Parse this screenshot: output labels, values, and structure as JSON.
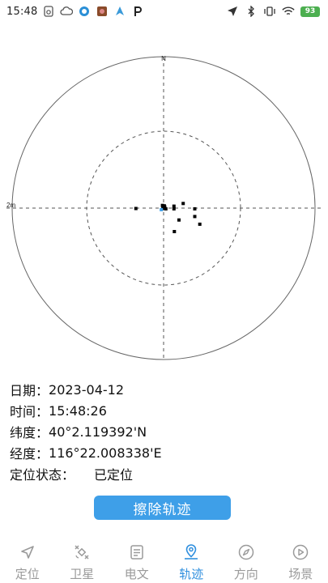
{
  "status_bar": {
    "time": "15:48",
    "battery": "93",
    "icons": [
      "sync-icon",
      "cloud-icon",
      "app-icon",
      "app-icon-2",
      "arrow-icon",
      "parking-icon",
      "location-icon",
      "bluetooth-icon",
      "vibrate-icon",
      "wifi-icon",
      "battery-icon"
    ]
  },
  "radar": {
    "north_label": "N",
    "scale_label": "2m",
    "points": [
      {
        "dx": 0.0,
        "dy": -0.2
      },
      {
        "dx": -0.3,
        "dy": -0.7
      },
      {
        "dx": 0.2,
        "dy": -0.6
      },
      {
        "dx": 0.3,
        "dy": -0.3
      },
      {
        "dx": -0.2,
        "dy": 0.1
      },
      {
        "dx": 0.6,
        "dy": 0.2
      },
      {
        "dx": -7.2,
        "dy": 0.1
      },
      {
        "dx": 2.7,
        "dy": -0.5
      },
      {
        "dx": 2.7,
        "dy": 0.2
      },
      {
        "dx": 5.1,
        "dy": -1.2
      },
      {
        "dx": 8.1,
        "dy": 0.2
      },
      {
        "dx": 8.1,
        "dy": 2.2
      },
      {
        "dx": 4.0,
        "dy": 3.1
      },
      {
        "dx": 9.4,
        "dy": 4.2
      },
      {
        "dx": 2.8,
        "dy": 6.1
      }
    ],
    "current_point": {
      "dx": -0.6,
      "dy": 0.4
    }
  },
  "info": {
    "date_label": "日期：",
    "date_value": "2023-04-12",
    "time_label": "时间：",
    "time_value": "15:48:26",
    "lat_label": "纬度：",
    "lat_value": "40°2.119392'N",
    "lon_label": "经度：",
    "lon_value": "116°22.008338'E",
    "state_label": "定位状态：",
    "state_value": "已定位"
  },
  "clear_button": "擦除轨迹",
  "nav": {
    "items": [
      {
        "label": "定位",
        "icon": "navigation-arrow-icon",
        "active": false
      },
      {
        "label": "卫星",
        "icon": "satellite-icon",
        "active": false
      },
      {
        "label": "电文",
        "icon": "message-list-icon",
        "active": false
      },
      {
        "label": "轨迹",
        "icon": "location-pin-icon",
        "active": true
      },
      {
        "label": "方向",
        "icon": "compass-icon",
        "active": false
      },
      {
        "label": "场景",
        "icon": "play-circle-icon",
        "active": false
      }
    ],
    "active_color": "#2f8fde",
    "inactive_color": "#9a9a9a"
  },
  "colors": {
    "button": "#3e9fe8",
    "battery": "#4caf50"
  }
}
